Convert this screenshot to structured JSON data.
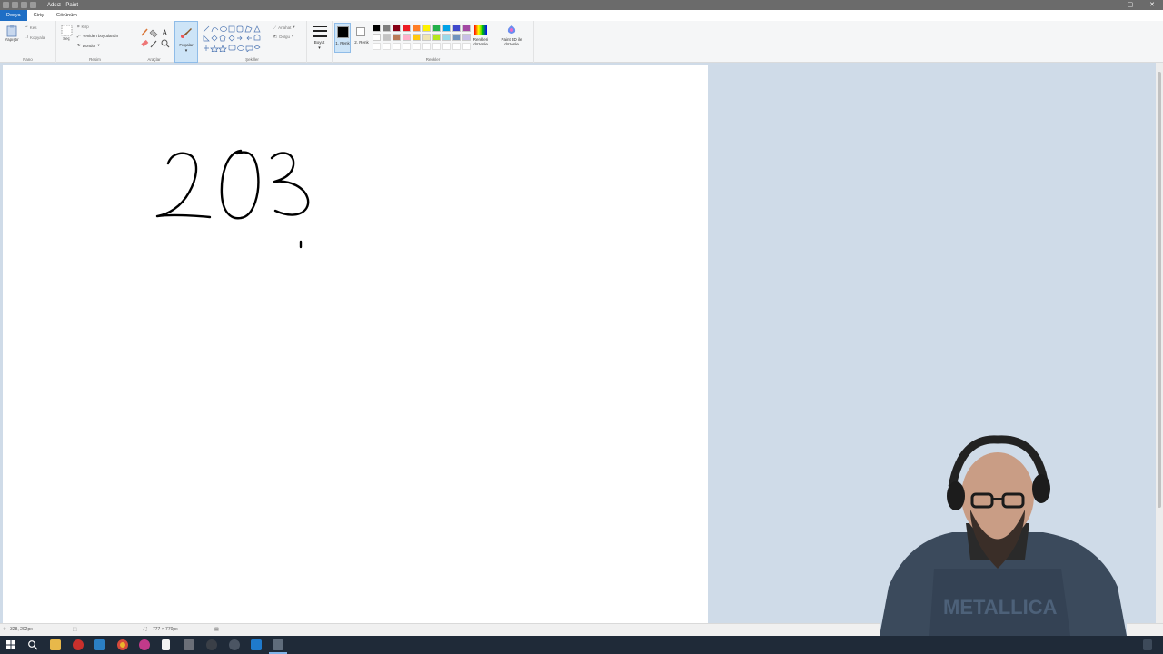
{
  "window": {
    "title": "Adsız - Paint"
  },
  "tabs": [
    {
      "label": "Dosya"
    },
    {
      "label": "Giriş"
    },
    {
      "label": "Görünüm"
    }
  ],
  "ribbon": {
    "clipboard": {
      "paste": "Yapıştır",
      "cut": "Kes",
      "copy": "Kopyala",
      "label": "Pano"
    },
    "image": {
      "select": "Seç",
      "crop": "Kırp",
      "resize": "Yeniden boyutlandır",
      "rotate": "Döndür",
      "label": "Resim"
    },
    "tools": {
      "label": "Araçlar"
    },
    "brushes": {
      "label": "Fırçalar"
    },
    "shapes": {
      "outline": "Anahat",
      "fill": "Dolgu",
      "label": "Şekiller"
    },
    "size": {
      "label": "Boyut"
    },
    "colors": {
      "color1": "1. Renk",
      "color2": "2. Renk",
      "edit": "Renkleri düzenle",
      "paint3d": "Paint 3D ile düzenle",
      "label": "Renkler",
      "palette_row1": [
        "#000000",
        "#7f7f7f",
        "#880015",
        "#ed1c24",
        "#ff7f27",
        "#fff200",
        "#22b14c",
        "#00a2e8",
        "#3f48cc",
        "#a349a4"
      ],
      "palette_row2": [
        "#ffffff",
        "#c3c3c3",
        "#b97a57",
        "#ffaec9",
        "#ffc90e",
        "#efe4b0",
        "#b5e61d",
        "#99d9ea",
        "#7092be",
        "#c8bfe7"
      ]
    }
  },
  "canvas": {
    "drawing_text": "203"
  },
  "statusbar": {
    "cursor_pos": "328, 202px",
    "canvas_size": "777 × 770px"
  }
}
